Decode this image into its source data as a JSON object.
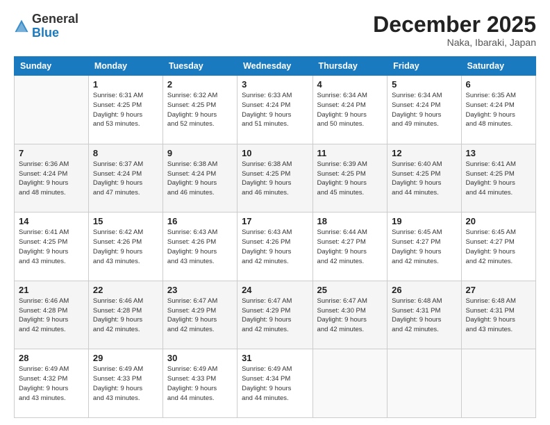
{
  "header": {
    "logo_general": "General",
    "logo_blue": "Blue",
    "month_title": "December 2025",
    "location": "Naka, Ibaraki, Japan"
  },
  "days_of_week": [
    "Sunday",
    "Monday",
    "Tuesday",
    "Wednesday",
    "Thursday",
    "Friday",
    "Saturday"
  ],
  "weeks": [
    [
      {
        "day": "",
        "info": ""
      },
      {
        "day": "1",
        "info": "Sunrise: 6:31 AM\nSunset: 4:25 PM\nDaylight: 9 hours\nand 53 minutes."
      },
      {
        "day": "2",
        "info": "Sunrise: 6:32 AM\nSunset: 4:25 PM\nDaylight: 9 hours\nand 52 minutes."
      },
      {
        "day": "3",
        "info": "Sunrise: 6:33 AM\nSunset: 4:24 PM\nDaylight: 9 hours\nand 51 minutes."
      },
      {
        "day": "4",
        "info": "Sunrise: 6:34 AM\nSunset: 4:24 PM\nDaylight: 9 hours\nand 50 minutes."
      },
      {
        "day": "5",
        "info": "Sunrise: 6:34 AM\nSunset: 4:24 PM\nDaylight: 9 hours\nand 49 minutes."
      },
      {
        "day": "6",
        "info": "Sunrise: 6:35 AM\nSunset: 4:24 PM\nDaylight: 9 hours\nand 48 minutes."
      }
    ],
    [
      {
        "day": "7",
        "info": "Sunrise: 6:36 AM\nSunset: 4:24 PM\nDaylight: 9 hours\nand 48 minutes."
      },
      {
        "day": "8",
        "info": "Sunrise: 6:37 AM\nSunset: 4:24 PM\nDaylight: 9 hours\nand 47 minutes."
      },
      {
        "day": "9",
        "info": "Sunrise: 6:38 AM\nSunset: 4:24 PM\nDaylight: 9 hours\nand 46 minutes."
      },
      {
        "day": "10",
        "info": "Sunrise: 6:38 AM\nSunset: 4:25 PM\nDaylight: 9 hours\nand 46 minutes."
      },
      {
        "day": "11",
        "info": "Sunrise: 6:39 AM\nSunset: 4:25 PM\nDaylight: 9 hours\nand 45 minutes."
      },
      {
        "day": "12",
        "info": "Sunrise: 6:40 AM\nSunset: 4:25 PM\nDaylight: 9 hours\nand 44 minutes."
      },
      {
        "day": "13",
        "info": "Sunrise: 6:41 AM\nSunset: 4:25 PM\nDaylight: 9 hours\nand 44 minutes."
      }
    ],
    [
      {
        "day": "14",
        "info": "Sunrise: 6:41 AM\nSunset: 4:25 PM\nDaylight: 9 hours\nand 43 minutes."
      },
      {
        "day": "15",
        "info": "Sunrise: 6:42 AM\nSunset: 4:26 PM\nDaylight: 9 hours\nand 43 minutes."
      },
      {
        "day": "16",
        "info": "Sunrise: 6:43 AM\nSunset: 4:26 PM\nDaylight: 9 hours\nand 43 minutes."
      },
      {
        "day": "17",
        "info": "Sunrise: 6:43 AM\nSunset: 4:26 PM\nDaylight: 9 hours\nand 42 minutes."
      },
      {
        "day": "18",
        "info": "Sunrise: 6:44 AM\nSunset: 4:27 PM\nDaylight: 9 hours\nand 42 minutes."
      },
      {
        "day": "19",
        "info": "Sunrise: 6:45 AM\nSunset: 4:27 PM\nDaylight: 9 hours\nand 42 minutes."
      },
      {
        "day": "20",
        "info": "Sunrise: 6:45 AM\nSunset: 4:27 PM\nDaylight: 9 hours\nand 42 minutes."
      }
    ],
    [
      {
        "day": "21",
        "info": "Sunrise: 6:46 AM\nSunset: 4:28 PM\nDaylight: 9 hours\nand 42 minutes."
      },
      {
        "day": "22",
        "info": "Sunrise: 6:46 AM\nSunset: 4:28 PM\nDaylight: 9 hours\nand 42 minutes."
      },
      {
        "day": "23",
        "info": "Sunrise: 6:47 AM\nSunset: 4:29 PM\nDaylight: 9 hours\nand 42 minutes."
      },
      {
        "day": "24",
        "info": "Sunrise: 6:47 AM\nSunset: 4:29 PM\nDaylight: 9 hours\nand 42 minutes."
      },
      {
        "day": "25",
        "info": "Sunrise: 6:47 AM\nSunset: 4:30 PM\nDaylight: 9 hours\nand 42 minutes."
      },
      {
        "day": "26",
        "info": "Sunrise: 6:48 AM\nSunset: 4:31 PM\nDaylight: 9 hours\nand 42 minutes."
      },
      {
        "day": "27",
        "info": "Sunrise: 6:48 AM\nSunset: 4:31 PM\nDaylight: 9 hours\nand 43 minutes."
      }
    ],
    [
      {
        "day": "28",
        "info": "Sunrise: 6:49 AM\nSunset: 4:32 PM\nDaylight: 9 hours\nand 43 minutes."
      },
      {
        "day": "29",
        "info": "Sunrise: 6:49 AM\nSunset: 4:33 PM\nDaylight: 9 hours\nand 43 minutes."
      },
      {
        "day": "30",
        "info": "Sunrise: 6:49 AM\nSunset: 4:33 PM\nDaylight: 9 hours\nand 44 minutes."
      },
      {
        "day": "31",
        "info": "Sunrise: 6:49 AM\nSunset: 4:34 PM\nDaylight: 9 hours\nand 44 minutes."
      },
      {
        "day": "",
        "info": ""
      },
      {
        "day": "",
        "info": ""
      },
      {
        "day": "",
        "info": ""
      }
    ]
  ]
}
